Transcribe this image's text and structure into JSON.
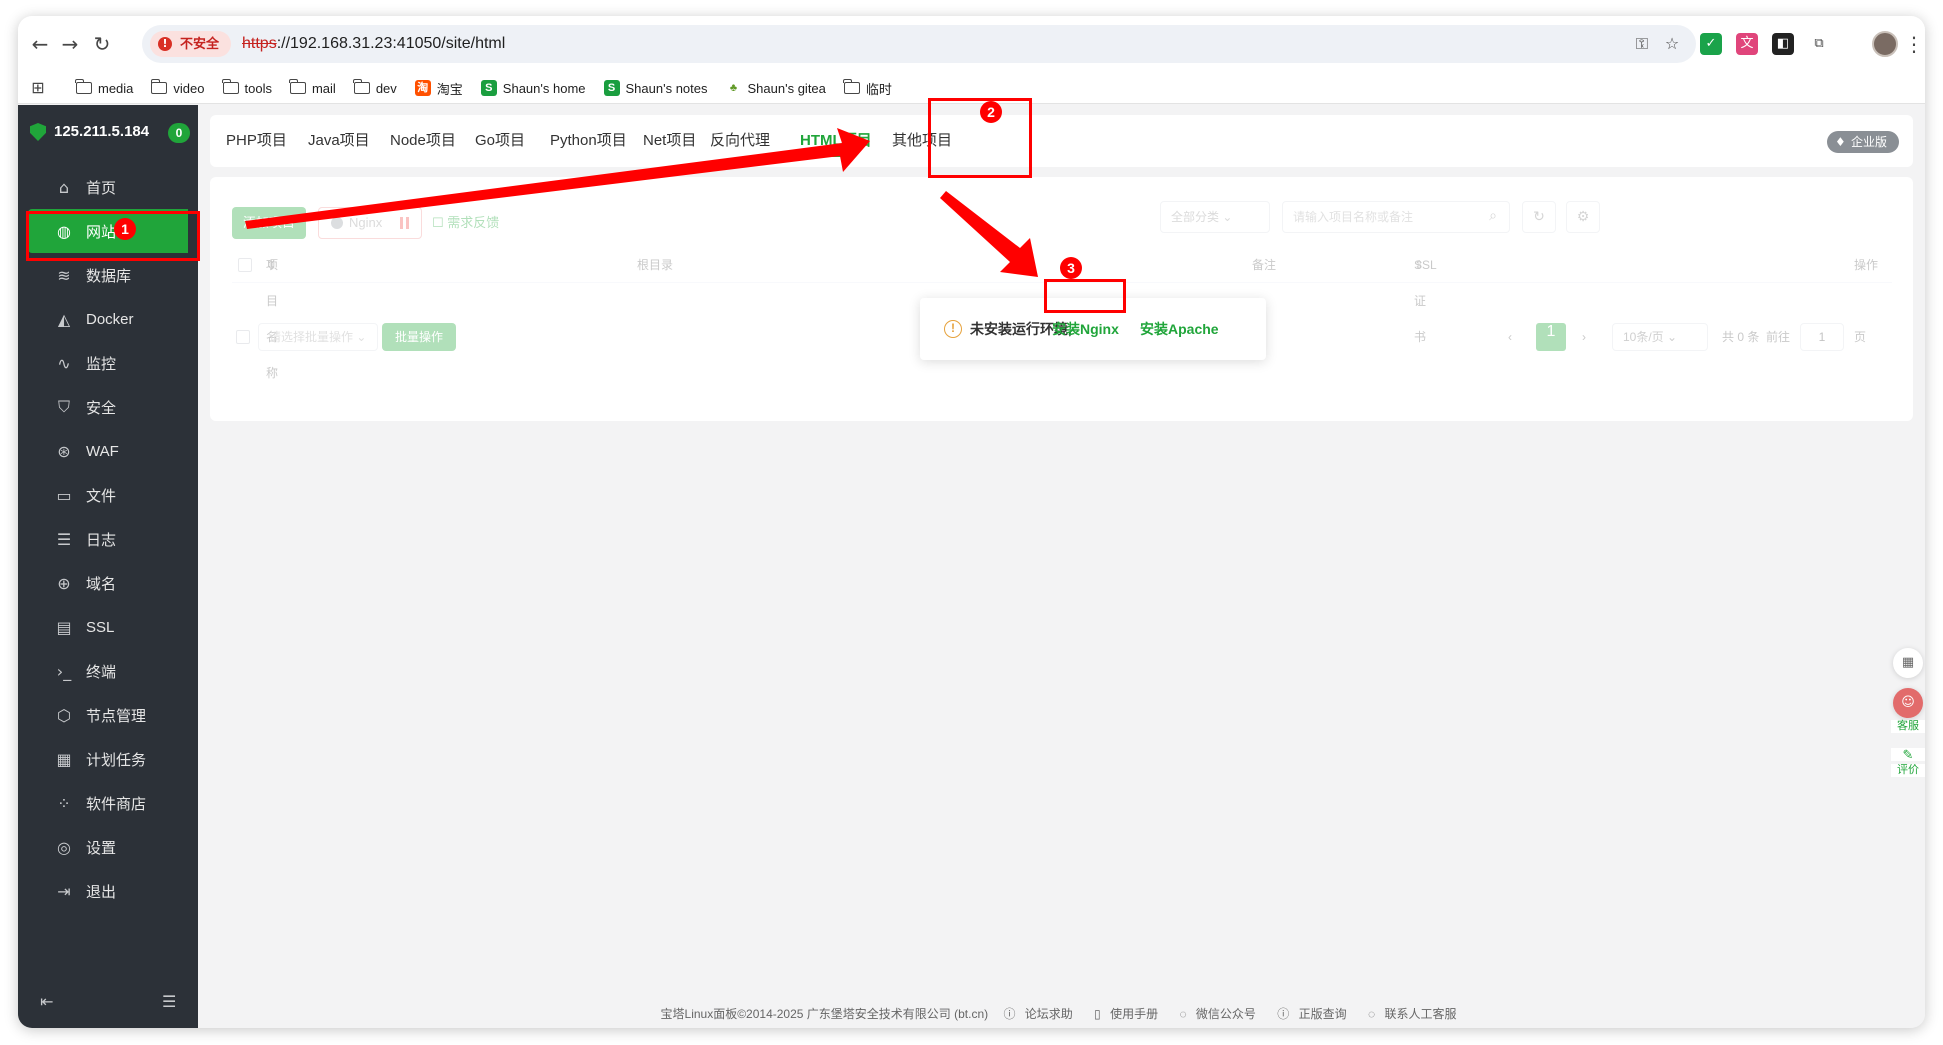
{
  "browser": {
    "security_label": "不安全",
    "url_protocol": "https",
    "url_rest": "://192.168.31.23:41050/site/html",
    "bookmarks": [
      {
        "label": "media",
        "type": "folder"
      },
      {
        "label": "video",
        "type": "folder"
      },
      {
        "label": "tools",
        "type": "folder"
      },
      {
        "label": "mail",
        "type": "folder"
      },
      {
        "label": "dev",
        "type": "folder"
      },
      {
        "label": "淘宝",
        "type": "taobao"
      },
      {
        "label": "Shaun's home",
        "type": "s-logo"
      },
      {
        "label": "Shaun's notes",
        "type": "s-logo"
      },
      {
        "label": "Shaun's gitea",
        "type": "gitea"
      },
      {
        "label": "临时",
        "type": "folder"
      }
    ]
  },
  "sidebar": {
    "ip": "125.211.5.184",
    "badge": "0",
    "items": [
      {
        "label": "首页",
        "icon": "home-icon",
        "glyph": "⌂"
      },
      {
        "label": "网站",
        "icon": "globe-icon",
        "glyph": "◍",
        "active": true
      },
      {
        "label": "数据库",
        "icon": "database-icon",
        "glyph": "≋"
      },
      {
        "label": "Docker",
        "icon": "docker-icon",
        "glyph": "◭"
      },
      {
        "label": "监控",
        "icon": "monitor-icon",
        "glyph": "∿"
      },
      {
        "label": "安全",
        "icon": "shield-icon",
        "glyph": "⛉"
      },
      {
        "label": "WAF",
        "icon": "waf-icon",
        "glyph": "⊛"
      },
      {
        "label": "文件",
        "icon": "folder-icon",
        "glyph": "▭"
      },
      {
        "label": "日志",
        "icon": "log-icon",
        "glyph": "☰"
      },
      {
        "label": "域名",
        "icon": "domain-icon",
        "glyph": "⊕"
      },
      {
        "label": "SSL",
        "icon": "ssl-icon",
        "glyph": "▤"
      },
      {
        "label": "终端",
        "icon": "terminal-icon",
        "glyph": "›_"
      },
      {
        "label": "节点管理",
        "icon": "node-icon",
        "glyph": "⬡"
      },
      {
        "label": "计划任务",
        "icon": "calendar-icon",
        "glyph": "▦"
      },
      {
        "label": "软件商店",
        "icon": "apps-icon",
        "glyph": "⁘"
      },
      {
        "label": "设置",
        "icon": "settings-icon",
        "glyph": "◎"
      },
      {
        "label": "退出",
        "icon": "logout-icon",
        "glyph": "⇥"
      }
    ]
  },
  "tabs": [
    "PHP项目",
    "Java项目",
    "Node项目",
    "Go项目",
    "Python项目",
    "Net项目",
    "反向代理",
    "HTML项目",
    "其他项目"
  ],
  "active_tab": "HTML项目",
  "enterprise_badge": "企业版",
  "toolbar": {
    "add_label": "添加项目",
    "nginx_label": "Nginx",
    "feedback_label": "需求反馈",
    "category_select": "全部分类",
    "search_placeholder": "请输入项目名称或备注"
  },
  "table": {
    "col_name": "项目名称",
    "col_root": "根目录",
    "col_note": "备注",
    "col_ssl": "SSL证书",
    "col_ops": "操作"
  },
  "pagination": {
    "batch_placeholder": "请选择批量操作",
    "batch_button": "批量操作",
    "current_page": "1",
    "page_size": "10条/页",
    "total_text": "共 0 条",
    "goto_label": "前往",
    "goto_value": "1",
    "page_unit": "页"
  },
  "popup": {
    "message": "未安装运行环境,",
    "install_nginx": "安装Nginx",
    "install_apache": "安装Apache"
  },
  "annotations": {
    "n1": "1",
    "n2": "2",
    "n3": "3",
    "color": "#ff0000"
  },
  "float_buttons": {
    "service_label": "客服",
    "review_label": "评价"
  },
  "footer": {
    "copyright": "宝塔Linux面板©2014-2025 广东堡塔安全技术有限公司 (bt.cn)",
    "links": [
      "论坛求助",
      "使用手册",
      "微信公众号",
      "正版查询",
      "联系人工客服"
    ]
  },
  "colors": {
    "brand": "#20a53a",
    "sidebar_bg": "#2c3138",
    "danger": "#ff0000"
  }
}
